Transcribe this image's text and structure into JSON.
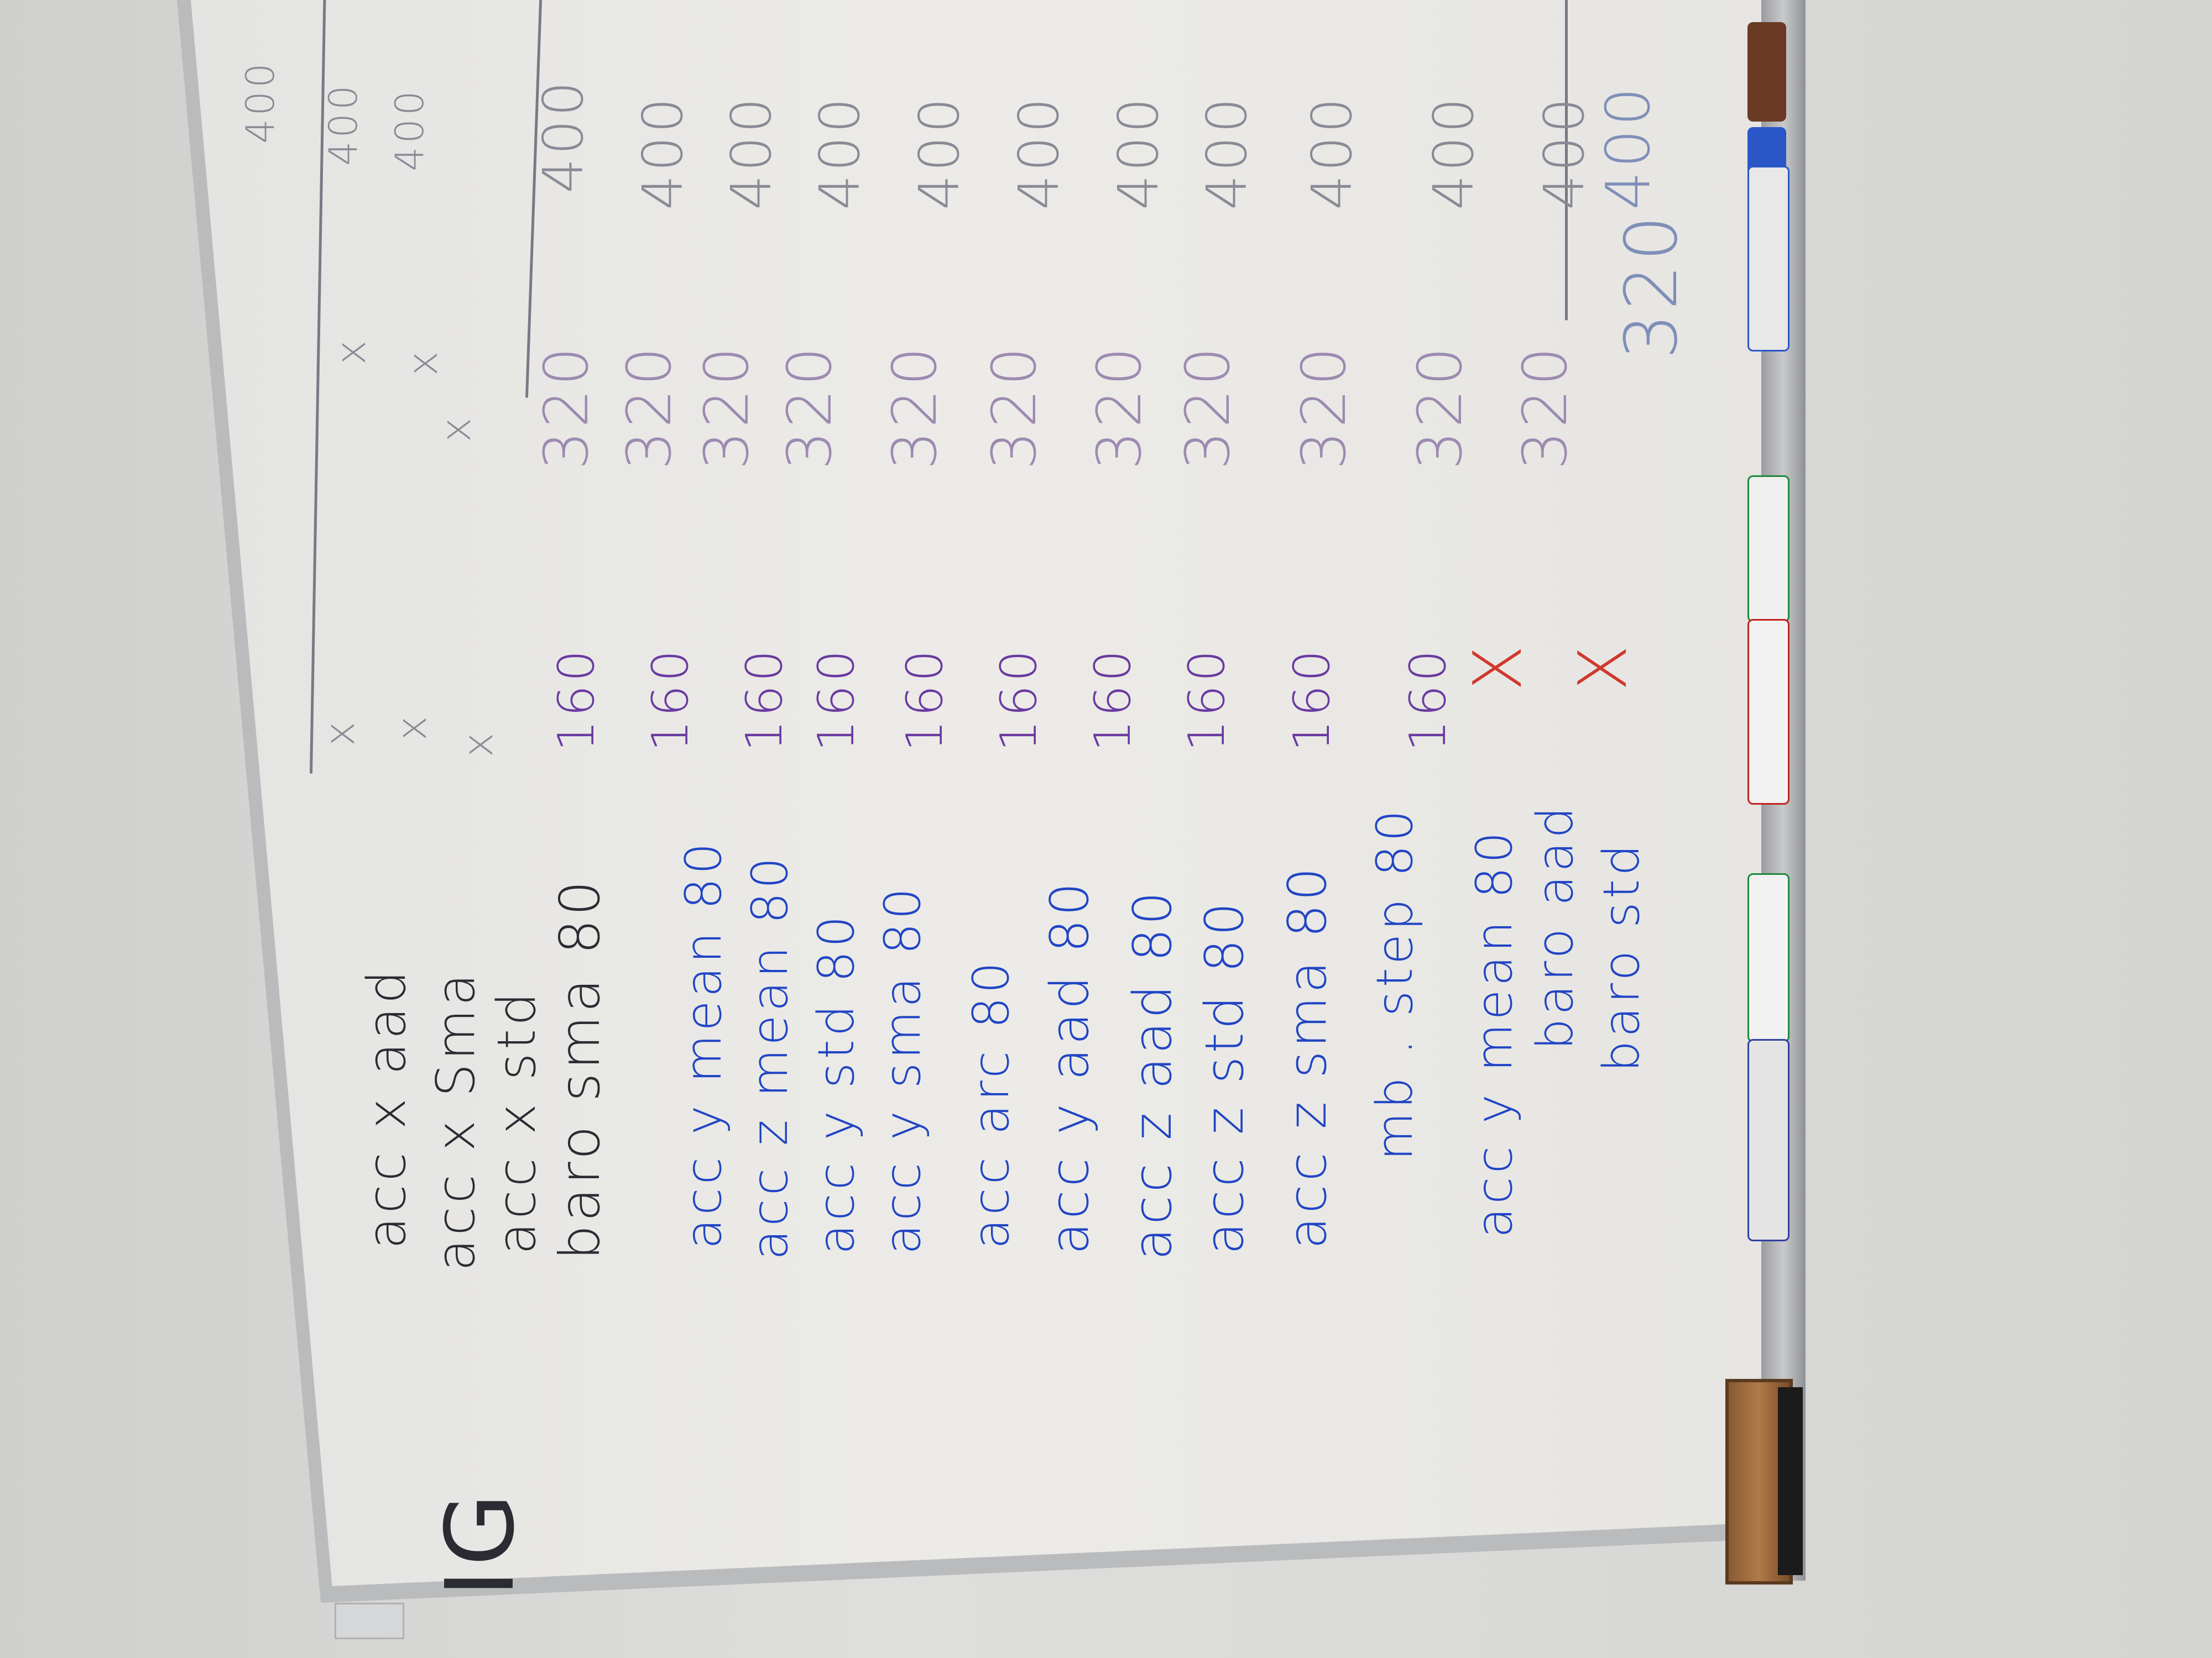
{
  "whiteboard": {
    "title": "IG",
    "rows": [
      {
        "label": "acc x aad",
        "c1": "x",
        "c2": "x",
        "c3": "400"
      },
      {
        "label": "acc x Sma",
        "c1": "x",
        "c2": "x",
        "c3": "400"
      },
      {
        "label": "acc x std",
        "c1": "x",
        "c2": "x",
        "c3": "400"
      },
      {
        "label": "baro sma 80",
        "c1": "160",
        "c2": "320",
        "c3": "400"
      },
      {
        "label": "acc y mean 80",
        "c1": "160",
        "c2": "320",
        "c3": "400"
      },
      {
        "label": "acc z mean 80",
        "c1": "160",
        "c2": "320",
        "c3": "400"
      },
      {
        "label": "acc y std 80",
        "c1": "160",
        "c2": "320",
        "c3": "400"
      },
      {
        "label": "acc y sma 80",
        "c1": "160",
        "c2": "320",
        "c3": "400"
      },
      {
        "label": "acc arc 80",
        "c1": "160",
        "c2": "320",
        "c3": "400"
      },
      {
        "label": "acc y aad 80",
        "c1": "160",
        "c2": "320",
        "c3": "400"
      },
      {
        "label": "acc z aad 80",
        "c1": "160",
        "c2": "320",
        "c3": "400"
      },
      {
        "label": "acc z std 80",
        "c1": "160",
        "c2": "320",
        "c3": "400"
      },
      {
        "label": "acc z sma 80",
        "c1": "160",
        "c2": "320",
        "c3": "400"
      },
      {
        "label": "mb . step 80",
        "c1": "160",
        "c2": "320",
        "c3": "400"
      },
      {
        "label": "acc y mean 80",
        "c1": "X",
        "c2": "320",
        "c3": "400"
      },
      {
        "label": "baro aad",
        "c1": "",
        "c2": "",
        "c3": ""
      },
      {
        "label": "baro std",
        "c1": "X",
        "c2": "320",
        "c3": "400"
      }
    ]
  }
}
